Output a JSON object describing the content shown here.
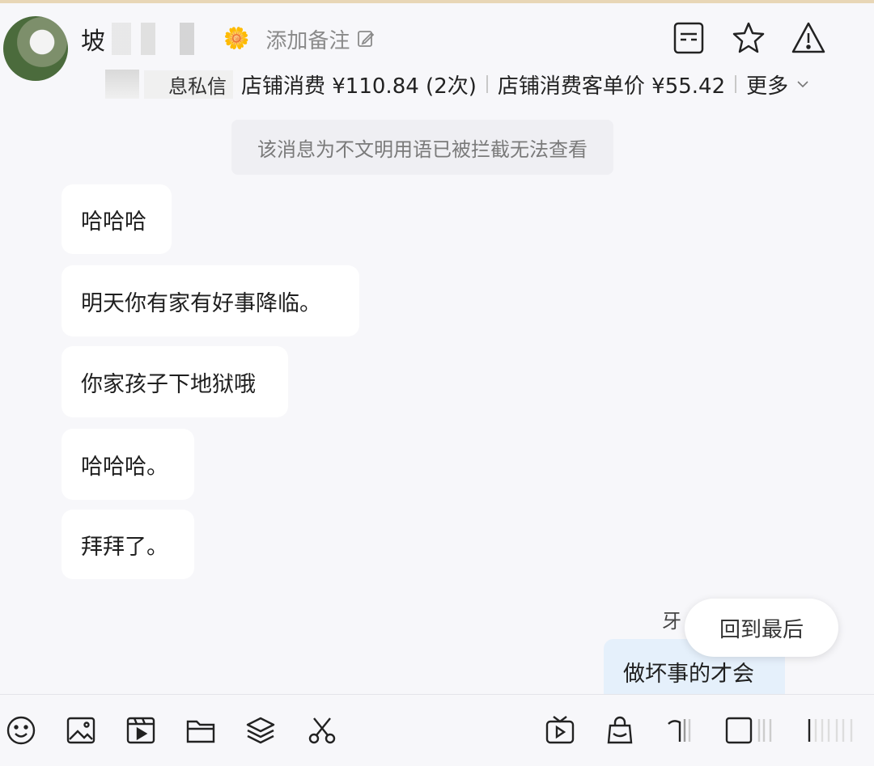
{
  "header": {
    "name": "坡",
    "remark_label": "添加备注",
    "badge_emoji": "🌼",
    "dm_label": "息私信",
    "spend_label": "店铺消费 ¥110.84 (2次)",
    "avg_price_label": "店铺消费客单价 ¥55.42",
    "more_label": "更多"
  },
  "messages": {
    "system_tip": "该消息为不文明用语已被拦截无法查看",
    "incoming": [
      "哈哈哈",
      "明天你有家有好事降临。",
      "你家孩子下地狱哦",
      "哈哈哈。",
      "拜拜了。"
    ],
    "outgoing_partial": "做坏事的才会",
    "outgoing_faded_prefix": "牙",
    "back_to_latest": "回到最后"
  },
  "toolbar_icons": [
    "emoji-icon",
    "image-icon",
    "video-icon",
    "folder-icon",
    "layers-icon",
    "scissors-icon",
    "play-card-icon",
    "shopping-bag-icon",
    "tag-icon",
    "card-icon",
    "more-icon"
  ],
  "colors": {
    "outgoing_bubble": "#e5f0fb",
    "incoming_bubble": "#ffffff",
    "background": "#f7f7fa"
  }
}
